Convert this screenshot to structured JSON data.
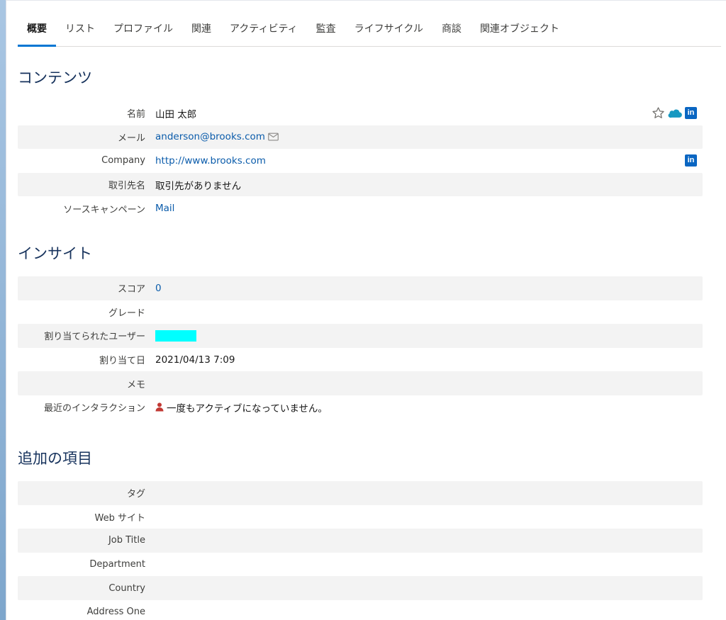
{
  "tabs": [
    {
      "label": "概要",
      "active": true
    },
    {
      "label": "リスト"
    },
    {
      "label": "プロファイル"
    },
    {
      "label": "関連"
    },
    {
      "label": "アクティビティ"
    },
    {
      "label": "監査"
    },
    {
      "label": "ライフサイクル"
    },
    {
      "label": "商談"
    },
    {
      "label": "関連オブジェクト"
    }
  ],
  "content": {
    "title": "コンテンツ",
    "name_label": "名前",
    "name_value": "山田 太郎",
    "email_label": "メール",
    "email_value": "anderson@brooks.com",
    "company_label": "Company",
    "company_value": "http://www.brooks.com",
    "account_label": "取引先名",
    "account_value": "取引先がありません",
    "campaign_label": "ソースキャンペーン",
    "campaign_value": "Mail"
  },
  "insight": {
    "title": "インサイト",
    "score_label": "スコア",
    "score_value": "0",
    "grade_label": "グレード",
    "grade_value": "",
    "assigned_user_label": "割り当てられたユーザー",
    "assigned_date_label": "割り当て日",
    "assigned_date_value": "2021/04/13 7:09",
    "memo_label": "メモ",
    "memo_value": "",
    "interaction_label": "最近のインタラクション",
    "interaction_value": "一度もアクティブになっていません。"
  },
  "additional": {
    "title": "追加の項目",
    "tag_label": "タグ",
    "website_label": "Web サイト",
    "job_title_label": "Job Title",
    "department_label": "Department",
    "country_label": "Country",
    "address_label": "Address One"
  },
  "icons": {
    "linkedin_text": "in",
    "linkedin_color": "#0a66c2",
    "salesforce_color": "#1798c1",
    "person_color": "#c23934",
    "link_color": "#0b5cab",
    "redaction_color": "#00ffff"
  }
}
